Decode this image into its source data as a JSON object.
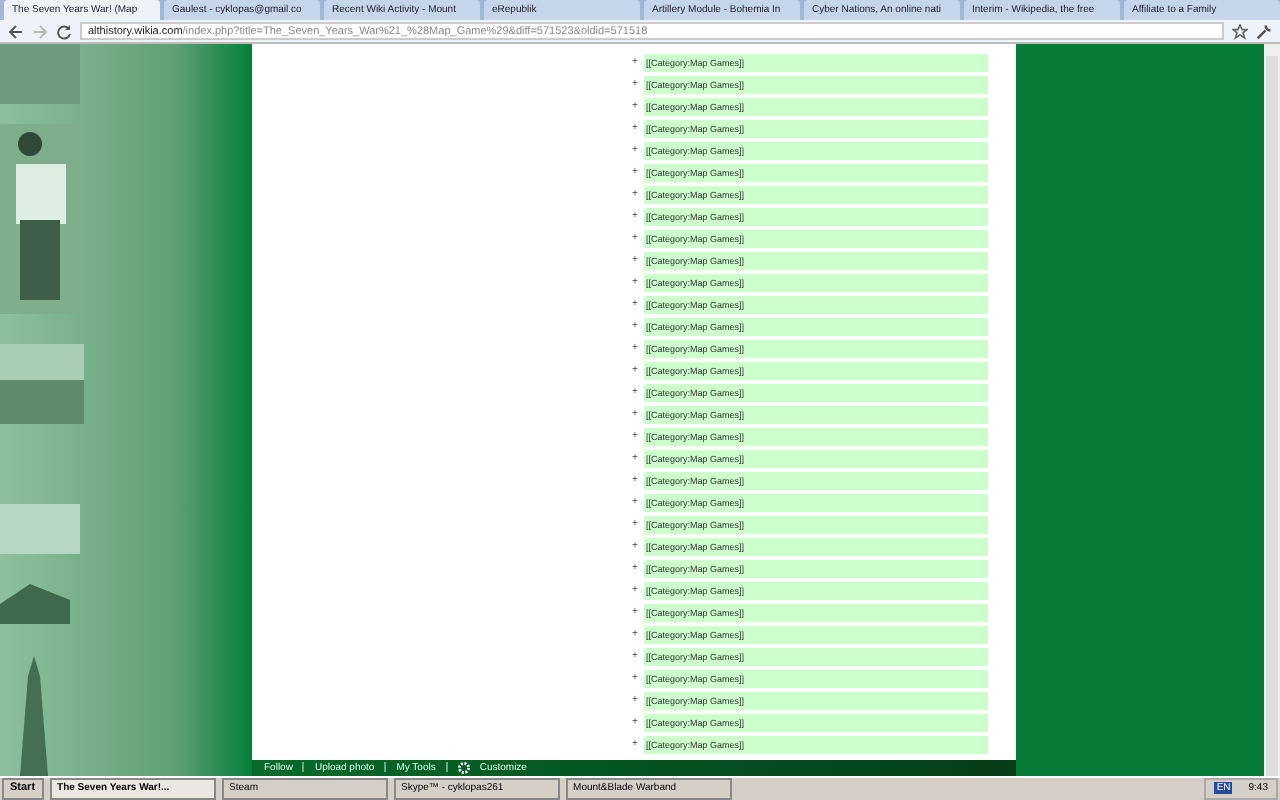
{
  "browser": {
    "tabs": [
      {
        "title": "The Seven Years War! (Map",
        "selected": true
      },
      {
        "title": "Gaulest - cyklopas@gmail.co",
        "selected": false
      },
      {
        "title": "Recent Wiki Activity - Mount",
        "selected": false
      },
      {
        "title": "eRepublik",
        "selected": false
      },
      {
        "title": "Artillery Module - Bohemia In",
        "selected": false
      },
      {
        "title": "Cyber Nations, An online nati",
        "selected": false
      },
      {
        "title": "Interim - Wikipedia, the free",
        "selected": false
      },
      {
        "title": "Affiliate to a Family",
        "selected": false
      }
    ],
    "url_host": "althistory.wikia.com",
    "url_path": "/index.php?title=The_Seven_Years_War%21_%28Map_Game%29&diff=571523&oldid=571518"
  },
  "diff": {
    "rows": [
      {
        "marker": "+",
        "text": "[[Category:Map Games]]"
      },
      {
        "marker": "+",
        "text": "[[Category:Map Games]]"
      },
      {
        "marker": "+",
        "text": "[[Category:Map Games]]"
      },
      {
        "marker": "+",
        "text": "[[Category:Map Games]]"
      },
      {
        "marker": "+",
        "text": "[[Category:Map Games]]"
      },
      {
        "marker": "+",
        "text": "[[Category:Map Games]]"
      },
      {
        "marker": "+",
        "text": "[[Category:Map Games]]"
      },
      {
        "marker": "+",
        "text": "[[Category:Map Games]]"
      },
      {
        "marker": "+",
        "text": "[[Category:Map Games]]"
      },
      {
        "marker": "+",
        "text": "[[Category:Map Games]]"
      },
      {
        "marker": "+",
        "text": "[[Category:Map Games]]"
      },
      {
        "marker": "+",
        "text": "[[Category:Map Games]]"
      },
      {
        "marker": "+",
        "text": "[[Category:Map Games]]"
      },
      {
        "marker": "+",
        "text": "[[Category:Map Games]]"
      },
      {
        "marker": "+",
        "text": "[[Category:Map Games]]"
      },
      {
        "marker": "+",
        "text": "[[Category:Map Games]]"
      },
      {
        "marker": "+",
        "text": "[[Category:Map Games]]"
      },
      {
        "marker": "+",
        "text": "[[Category:Map Games]]"
      },
      {
        "marker": "+",
        "text": "[[Category:Map Games]]"
      },
      {
        "marker": "+",
        "text": "[[Category:Map Games]]"
      },
      {
        "marker": "+",
        "text": "[[Category:Map Games]]"
      },
      {
        "marker": "+",
        "text": "[[Category:Map Games]]"
      },
      {
        "marker": "+",
        "text": "[[Category:Map Games]]"
      },
      {
        "marker": "+",
        "text": "[[Category:Map Games]]"
      },
      {
        "marker": "+",
        "text": "[[Category:Map Games]]"
      },
      {
        "marker": "+",
        "text": "[[Category:Map Games]]"
      },
      {
        "marker": "+",
        "text": "[[Category:Map Games]]"
      },
      {
        "marker": "+",
        "text": "[[Category:Map Games]]"
      },
      {
        "marker": "+",
        "text": "[[Category:Map Games]]"
      },
      {
        "marker": "+",
        "text": "[[Category:Map Games]]"
      },
      {
        "marker": "+",
        "text": "[[Category:Map Games]]"
      },
      {
        "marker": "+",
        "text": "[[Category:Map Games]]"
      }
    ]
  },
  "wiki_toolbar": [
    "Follow",
    "Upload photo",
    "My Tools",
    "Customize"
  ],
  "taskbar": {
    "start": "Start",
    "tasks": [
      {
        "title": "The Seven Years War!...",
        "selected": true
      },
      {
        "title": "Steam",
        "selected": false
      },
      {
        "title": "Skype™ - cyklopas261",
        "selected": false
      },
      {
        "title": "Mount&Blade Warband",
        "selected": false
      }
    ],
    "language": "EN",
    "clock": "9:43"
  }
}
